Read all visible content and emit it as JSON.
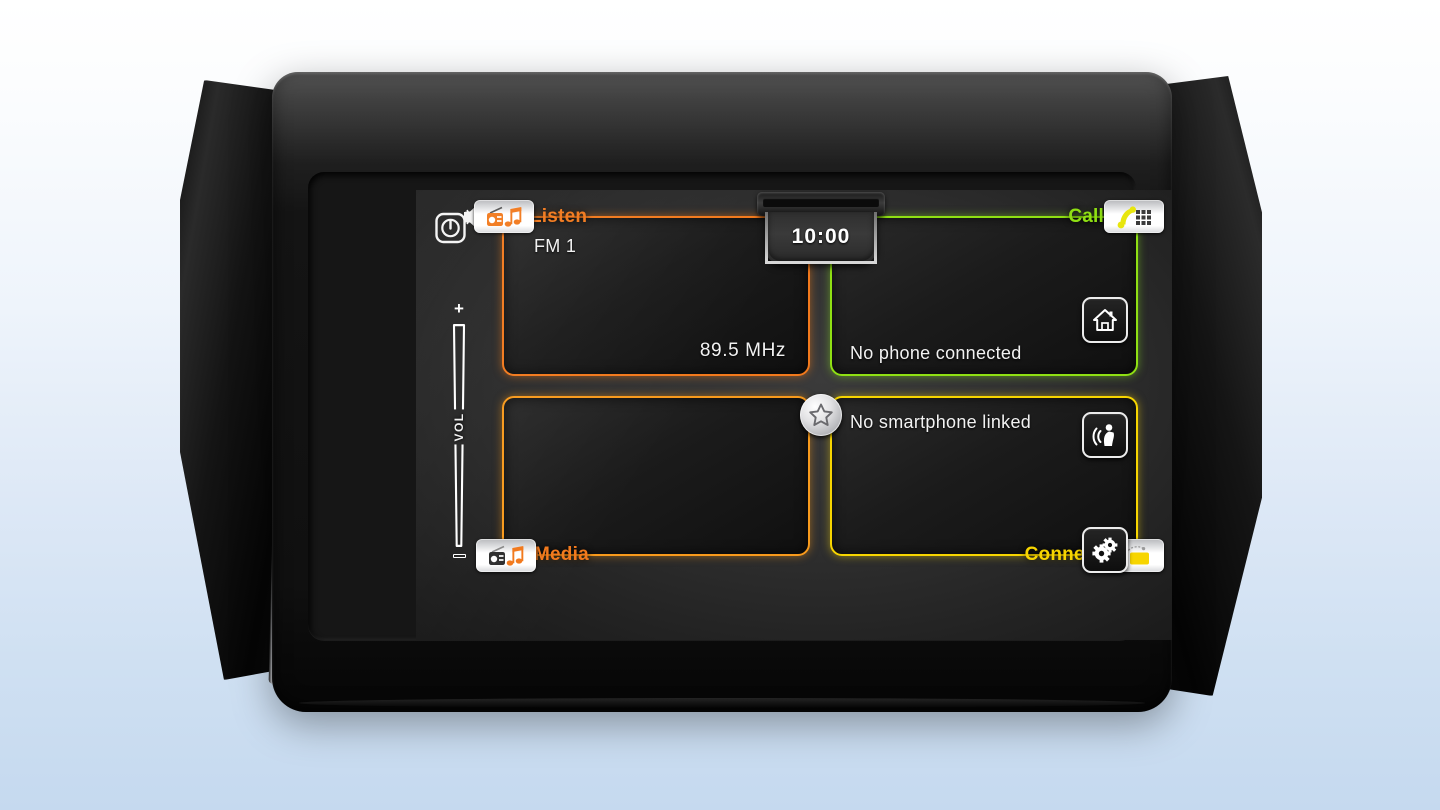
{
  "device": {
    "name": "Car Infotainment Head Unit",
    "screen_label": "Home Screen"
  },
  "screen": {
    "clock": "10:00",
    "power_button": {
      "icon": "power-mute-icon",
      "label": "Power / Mute"
    },
    "volume": {
      "plus": "+",
      "label": "VOL",
      "minus": "–"
    },
    "center_button": {
      "icon": "star-favourite-icon",
      "label": "Favourites"
    },
    "tiles": [
      {
        "key": "listen",
        "title": "Listen",
        "icon": "radio-music-icon",
        "accent": "#f2791c",
        "line_a": "FM 1",
        "line_b": "89.5  MHz"
      },
      {
        "key": "call",
        "title": "Call",
        "icon": "phone-keypad-icon",
        "accent": "#8fe013",
        "line_a": "No phone connected",
        "line_b": ""
      },
      {
        "key": "media",
        "title": "Media",
        "icon": "media-music-icon",
        "accent": "#f89a1c",
        "line_a": "",
        "line_b": ""
      },
      {
        "key": "connect",
        "title": "Connect",
        "icon": "smartphone-link-icon",
        "accent": "#f7d500",
        "line_a": "No smartphone linked",
        "line_b": ""
      }
    ]
  },
  "hard_buttons": [
    {
      "key": "home",
      "icon": "home-icon",
      "label": "Home"
    },
    {
      "key": "voice",
      "icon": "voice-command-icon",
      "label": "Voice Command"
    },
    {
      "key": "settings",
      "icon": "gears-settings-icon",
      "label": "Settings"
    }
  ],
  "colors": {
    "accent_orange": "#f2791c",
    "accent_orange_light": "#f89a1c",
    "accent_green": "#8fe013",
    "accent_yellow": "#f7d500",
    "screen_bg": "#303030",
    "background_top": "#ffffff",
    "background_bottom": "#c5d9ef"
  }
}
